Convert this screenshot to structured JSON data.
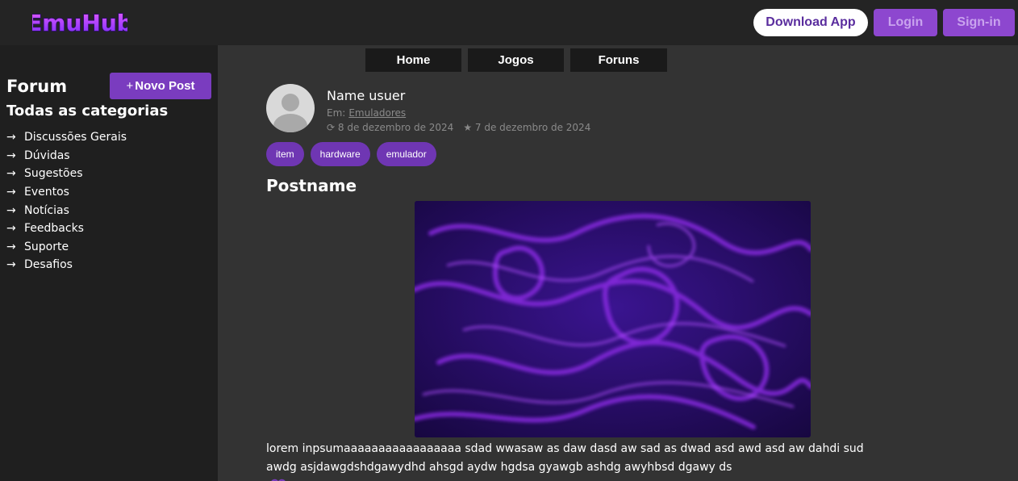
{
  "header": {
    "logo_text": "EmuHub",
    "download_label": "Download App",
    "login_label": "Login",
    "signin_label": "Sign-in"
  },
  "nav": {
    "home": "Home",
    "jogos": "Jogos",
    "foruns": "Foruns"
  },
  "sidebar": {
    "title": "Forum",
    "new_post_label": "Novo Post",
    "categories_heading": "Todas as categorias",
    "items": [
      {
        "label": "Discussões Gerais"
      },
      {
        "label": "Dúvidas"
      },
      {
        "label": "Sugestões"
      },
      {
        "label": "Eventos"
      },
      {
        "label": "Notícias"
      },
      {
        "label": "Feedbacks"
      },
      {
        "label": "Suporte"
      },
      {
        "label": "Desafios"
      }
    ]
  },
  "post": {
    "author": "Name usuer",
    "category_prefix": "Em:",
    "category": "Emuladores",
    "updated_date": "8 de dezembro de 2024",
    "created_date": "7 de dezembro de 2024",
    "tags": [
      "item",
      "hardware",
      "emulador"
    ],
    "title": "Postname",
    "body": "lorem inpsumaaaaaaaaaaaaaaaaa sdad wwasaw as daw dasd aw sad as dwad asd awd asd aw dahdi sud awdg asjdawgdshdgawydhd ahsgd aydw hgdsa gyawgb ashdg awyhbsd dgawy ds"
  },
  "colors": {
    "accent": "#7a3cbf",
    "accent_light": "#8d47cf",
    "background": "#333333",
    "sidebar": "#1f1f1f",
    "topbar": "#242424"
  },
  "icons": {
    "arrow": "arrow-right-icon",
    "refresh": "refresh-icon",
    "star": "star-icon",
    "heart": "heart-icon"
  }
}
